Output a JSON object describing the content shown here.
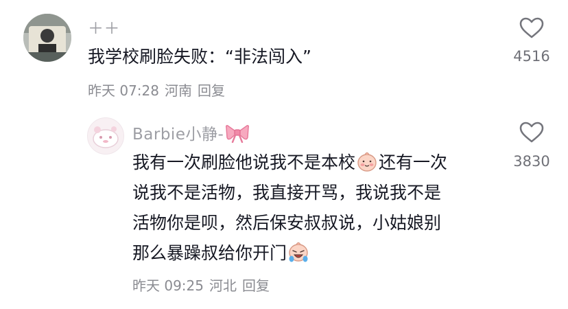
{
  "comment": {
    "username": "＋＋",
    "text": "我学校刷脸失败：“非法闯入”",
    "time": "昨天 07:28",
    "location": "河南",
    "reply_label": "回复",
    "like_count": "4516",
    "avatar_icon": "user-avatar-photo"
  },
  "reply": {
    "username": "Barbie小静-",
    "username_emoji": "pink-bow-icon",
    "lines": [
      "我有一次刷脸他说我不是本校",
      "还有一次",
      "说我不是活物，我直接开骂，我说我不是",
      "活物你是呗，然后保安叔叔说，小姑娘别",
      "那么暴躁叔给你开门"
    ],
    "inline_emojis": [
      "shy-face-emoji",
      "laugh-cry-face-emoji"
    ],
    "time": "昨天 09:25",
    "location": "河北",
    "reply_label": "回复",
    "like_count": "3830",
    "avatar_icon": "user-avatar-illustration"
  },
  "colors": {
    "text": "#161823",
    "muted": "#8a8b91",
    "username": "#9d9ea4",
    "bow": "#f08aa8",
    "emoji_face": "#fbd5c6"
  }
}
